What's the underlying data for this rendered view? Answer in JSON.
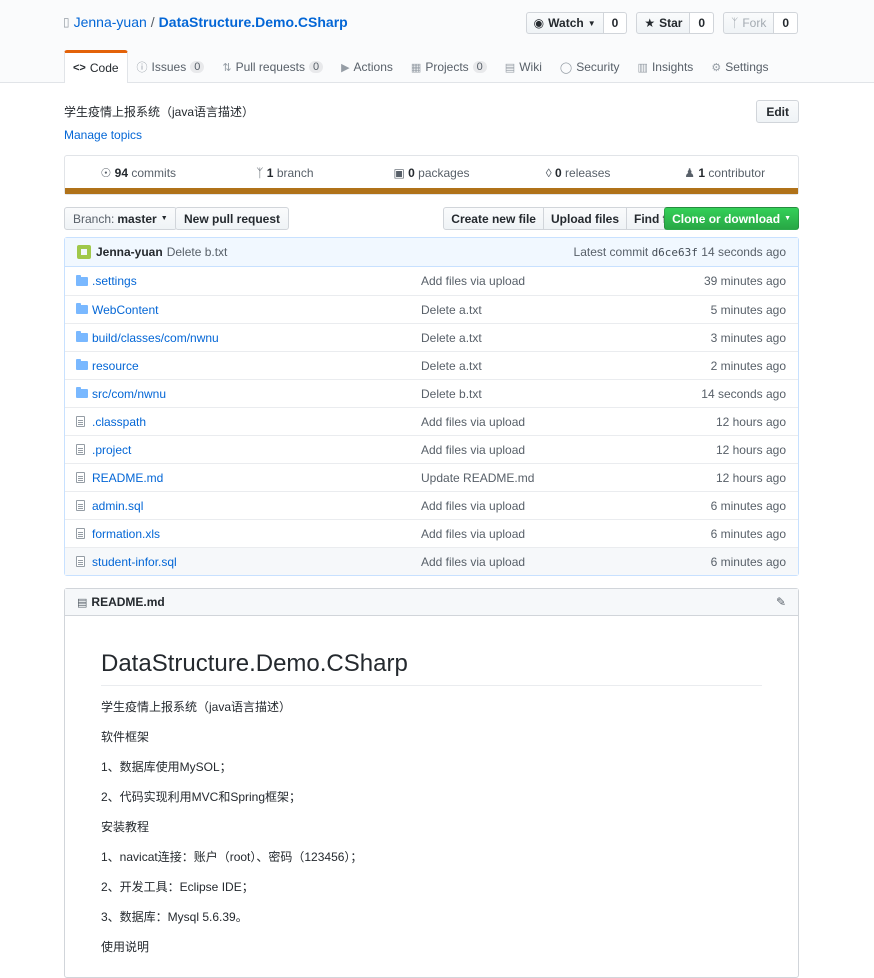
{
  "repo": {
    "owner": "Jenna-yuan",
    "separator": "/",
    "name": "DataStructure.Demo.CSharp"
  },
  "actions": {
    "watch": {
      "label": "Watch",
      "count": "0"
    },
    "star": {
      "label": "Star",
      "count": "0"
    },
    "fork": {
      "label": "Fork",
      "count": "0"
    }
  },
  "tabs": [
    {
      "label": "Code",
      "count": null,
      "icon": "code-icon"
    },
    {
      "label": "Issues",
      "count": "0",
      "icon": "issue-icon"
    },
    {
      "label": "Pull requests",
      "count": "0",
      "icon": "pr-icon"
    },
    {
      "label": "Actions",
      "count": null,
      "icon": "play-icon"
    },
    {
      "label": "Projects",
      "count": "0",
      "icon": "project-icon"
    },
    {
      "label": "Wiki",
      "count": null,
      "icon": "book-icon"
    },
    {
      "label": "Security",
      "count": null,
      "icon": "shield-icon"
    },
    {
      "label": "Insights",
      "count": null,
      "icon": "graph-icon"
    },
    {
      "label": "Settings",
      "count": null,
      "icon": "gear-icon"
    }
  ],
  "description": "学生疫情上报系统（java语言描述）",
  "manage_topics": "Manage topics",
  "edit_label": "Edit",
  "summary": {
    "commits_n": "94",
    "commits": "commits",
    "branch_n": "1",
    "branch": "branch",
    "packages_n": "0",
    "packages": "packages",
    "releases_n": "0",
    "releases": "releases",
    "contrib_n": "1",
    "contrib": "contributor"
  },
  "lang_color": "#b07219",
  "nav": {
    "branch_prefix": "Branch:",
    "branch": "master",
    "new_pr": "New pull request",
    "create_file": "Create new file",
    "upload": "Upload files",
    "find": "Find file",
    "clone": "Clone or download"
  },
  "commit": {
    "author": "Jenna-yuan",
    "message": "Delete b.txt",
    "latest_label": "Latest commit",
    "sha": "d6ce63f",
    "time": "14 seconds ago"
  },
  "files": [
    {
      "type": "dir",
      "name": ".settings",
      "msg": "Add files via upload",
      "age": "39 minutes ago"
    },
    {
      "type": "dir",
      "name": "WebContent",
      "msg": "Delete a.txt",
      "age": "5 minutes ago"
    },
    {
      "type": "dir",
      "name": "build/classes/com/nwnu",
      "msg": "Delete a.txt",
      "age": "3 minutes ago"
    },
    {
      "type": "dir",
      "name": "resource",
      "msg": "Delete a.txt",
      "age": "2 minutes ago"
    },
    {
      "type": "dir",
      "name": "src/com/nwnu",
      "msg": "Delete b.txt",
      "age": "14 seconds ago"
    },
    {
      "type": "file",
      "name": ".classpath",
      "msg": "Add files via upload",
      "age": "12 hours ago"
    },
    {
      "type": "file",
      "name": ".project",
      "msg": "Add files via upload",
      "age": "12 hours ago"
    },
    {
      "type": "file",
      "name": "README.md",
      "msg": "Update README.md",
      "age": "12 hours ago"
    },
    {
      "type": "file",
      "name": "admin.sql",
      "msg": "Add files via upload",
      "age": "6 minutes ago"
    },
    {
      "type": "file",
      "name": "formation.xls",
      "msg": "Add files via upload",
      "age": "6 minutes ago"
    },
    {
      "type": "file",
      "name": "student-infor.sql",
      "msg": "Add files via upload",
      "age": "6 minutes ago"
    }
  ],
  "readme": {
    "filename": "README.md",
    "title": "DataStructure.Demo.CSharp",
    "paragraphs": [
      "学生疫情上报系统（java语言描述）",
      "软件框架",
      "1、数据库使用MySOL；",
      "2、代码实现利用MVC和Spring框架；",
      "安装教程",
      "1、navicat连接：账户（root）、密码（123456）；",
      "2、开发工具：Eclipse IDE；",
      "3、数据库：Mysql 5.6.39。",
      "使用说明"
    ]
  }
}
